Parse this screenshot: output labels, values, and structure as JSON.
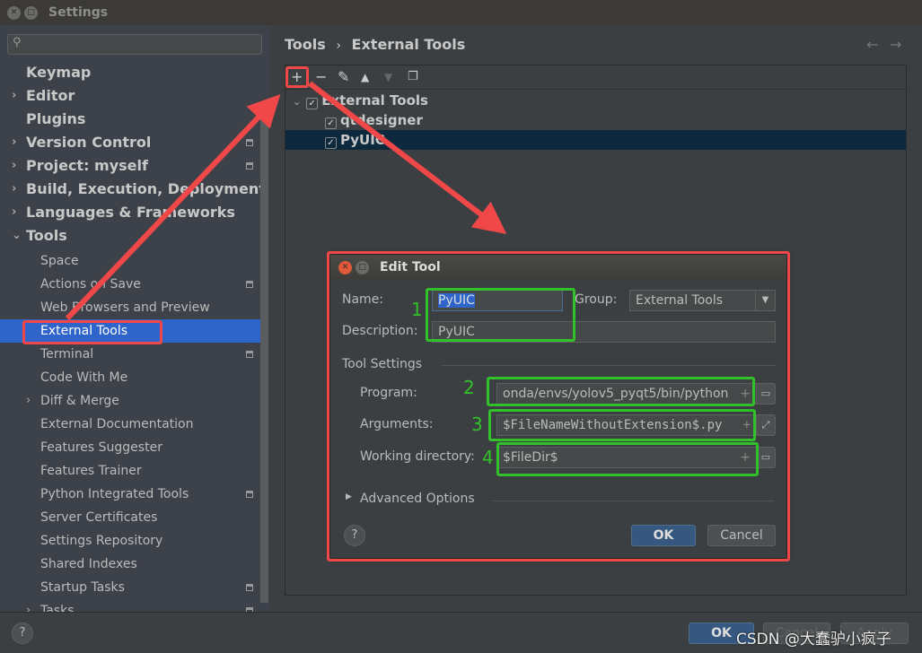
{
  "window": {
    "title": "Settings"
  },
  "sidebar": {
    "search_placeholder": "",
    "items": [
      {
        "label": "Keymap",
        "level": 0,
        "expand": false,
        "cfg": false
      },
      {
        "label": "Editor",
        "level": 0,
        "expand": true,
        "cfg": false
      },
      {
        "label": "Plugins",
        "level": 0,
        "expand": false,
        "cfg": false
      },
      {
        "label": "Version Control",
        "level": 0,
        "expand": true,
        "cfg": true
      },
      {
        "label": "Project: myself",
        "level": 0,
        "expand": true,
        "cfg": true
      },
      {
        "label": "Build, Execution, Deployment",
        "level": 0,
        "expand": true,
        "cfg": false
      },
      {
        "label": "Languages & Frameworks",
        "level": 0,
        "expand": true,
        "cfg": false
      },
      {
        "label": "Tools",
        "level": 0,
        "expand": "open",
        "cfg": false
      },
      {
        "label": "Space",
        "level": 1,
        "cfg": false
      },
      {
        "label": "Actions on Save",
        "level": 1,
        "cfg": true
      },
      {
        "label": "Web Browsers and Preview",
        "level": 1,
        "cfg": false
      },
      {
        "label": "External Tools",
        "level": 1,
        "cfg": false,
        "selected": true
      },
      {
        "label": "Terminal",
        "level": 1,
        "cfg": true
      },
      {
        "label": "Code With Me",
        "level": 1,
        "cfg": false
      },
      {
        "label": "Diff & Merge",
        "level": 1,
        "expand": true,
        "cfg": false
      },
      {
        "label": "External Documentation",
        "level": 1,
        "cfg": false
      },
      {
        "label": "Features Suggester",
        "level": 1,
        "cfg": false
      },
      {
        "label": "Features Trainer",
        "level": 1,
        "cfg": false
      },
      {
        "label": "Python Integrated Tools",
        "level": 1,
        "cfg": true
      },
      {
        "label": "Server Certificates",
        "level": 1,
        "cfg": false
      },
      {
        "label": "Settings Repository",
        "level": 1,
        "cfg": false
      },
      {
        "label": "Shared Indexes",
        "level": 1,
        "cfg": false
      },
      {
        "label": "Startup Tasks",
        "level": 1,
        "cfg": true
      },
      {
        "label": "Tasks",
        "level": 1,
        "expand": true,
        "cfg": true
      }
    ]
  },
  "breadcrumb": {
    "parent": "Tools",
    "separator": "›",
    "current": "External Tools"
  },
  "toolbar": {
    "icons": [
      "plus-icon",
      "minus-icon",
      "pencil-icon",
      "arrow-up-icon",
      "arrow-down-icon",
      "copy-icon"
    ]
  },
  "tree": {
    "group": "External Tools",
    "items": [
      {
        "label": "qtdesigner",
        "checked": true
      },
      {
        "label": "PyUIC",
        "checked": true,
        "selected": true
      }
    ]
  },
  "dialog": {
    "title": "Edit Tool",
    "name_label": "Name:",
    "name_value": "PyUIC",
    "group_label": "Group:",
    "group_value": "External Tools",
    "description_label": "Description:",
    "description_value": "PyUIC",
    "tool_settings": "Tool Settings",
    "program_label": "Program:",
    "program_value": "onda/envs/yolov5_pyqt5/bin/python",
    "arguments_label": "Arguments:",
    "arguments_value": "$FileNameWithoutExtension$.py",
    "workdir_label": "Working directory:",
    "workdir_value": "$FileDir$",
    "advanced": "Advanced Options",
    "ok": "OK",
    "cancel": "Cancel",
    "help": "?"
  },
  "footer": {
    "help": "?",
    "ok": "OK",
    "cancel": "Cancel",
    "apply": "Apply"
  },
  "annotations": {
    "numbers": [
      "1",
      "2",
      "3",
      "4"
    ],
    "watermark": "CSDN @大蠢驴小疯子",
    "red": "#f04848",
    "green": "#33c12b"
  }
}
